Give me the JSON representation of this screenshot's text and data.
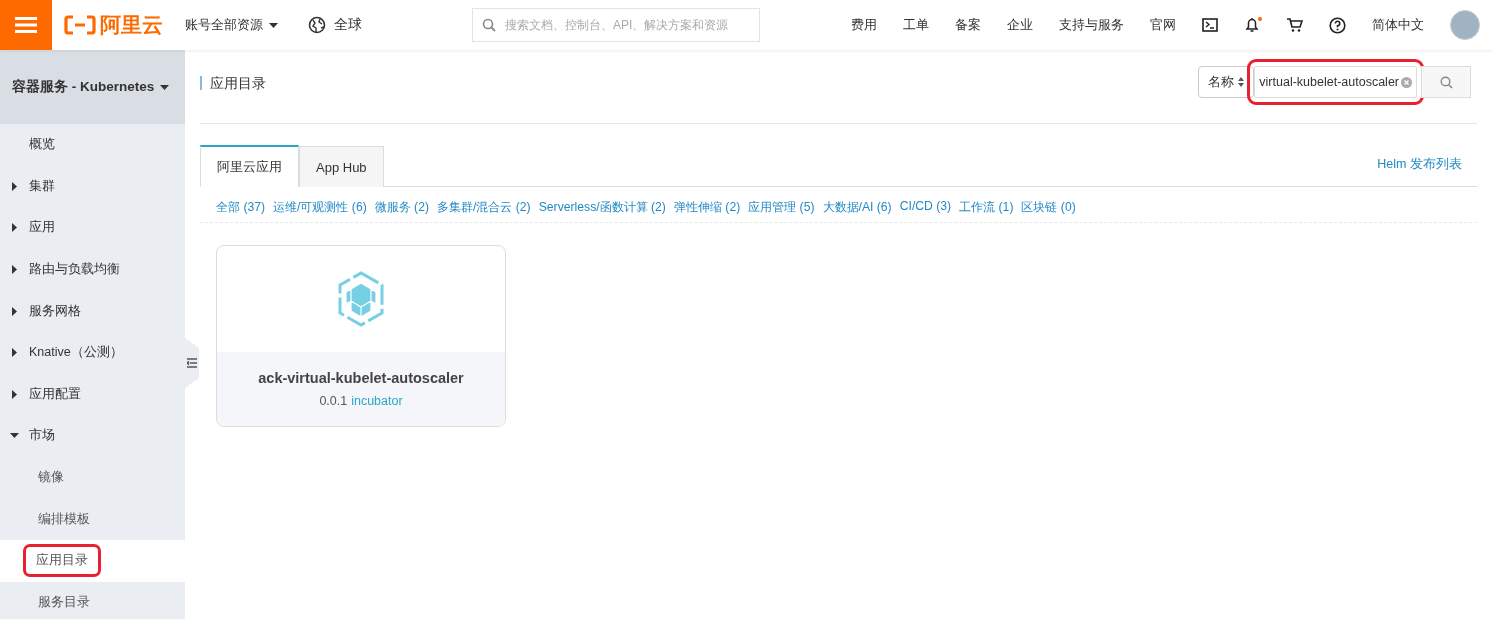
{
  "topbar": {
    "brand": "阿里云",
    "account_menu": "账号全部资源",
    "region": "全球",
    "search": {
      "placeholder": "搜索文档、控制台、API、解决方案和资源"
    },
    "links": [
      "费用",
      "工单",
      "备案",
      "企业",
      "支持与服务",
      "官网"
    ],
    "notification_unread": true,
    "language": "简体中文"
  },
  "sidebar": {
    "title": "容器服务 - Kubernetes",
    "items": [
      {
        "label": "概览",
        "kind": "leaf",
        "selected": false,
        "highlighted": false
      },
      {
        "label": "集群",
        "kind": "group",
        "expanded": false
      },
      {
        "label": "应用",
        "kind": "group",
        "expanded": false
      },
      {
        "label": "路由与负载均衡",
        "kind": "group",
        "expanded": false
      },
      {
        "label": "服务网格",
        "kind": "group",
        "expanded": false
      },
      {
        "label": "Knative（公测）",
        "kind": "group",
        "expanded": false
      },
      {
        "label": "应用配置",
        "kind": "group",
        "expanded": false
      },
      {
        "label": "市场",
        "kind": "group",
        "expanded": true,
        "children": [
          {
            "label": "镜像",
            "kind": "leaf",
            "selected": false,
            "highlighted": false
          },
          {
            "label": "编排模板",
            "kind": "leaf",
            "selected": false,
            "highlighted": false
          },
          {
            "label": "应用目录",
            "kind": "leaf",
            "selected": true,
            "highlighted": true
          },
          {
            "label": "服务目录",
            "kind": "leaf",
            "selected": false,
            "highlighted": false
          }
        ]
      }
    ]
  },
  "page": {
    "title": "应用目录",
    "filter": {
      "field": "名称",
      "value": "virtual-kubelet-autoscaler",
      "highlighted": true
    },
    "tabs": [
      {
        "label": "阿里云应用",
        "selected": true
      },
      {
        "label": "App Hub",
        "selected": false
      }
    ],
    "helm_link": "Helm 发布列表",
    "categories": [
      "全部 (37)",
      "运维/可观测性 (6)",
      "微服务 (2)",
      "多集群/混合云 (2)",
      "Serverless/函数计算 (2)",
      "弹性伸缩 (2)",
      "应用管理 (5)",
      "大数据/AI (6)",
      "CI/CD (3)",
      "工作流 (1)",
      "区块链 (0)"
    ],
    "apps": [
      {
        "name": "ack-virtual-kubelet-autoscaler",
        "version": "0.0.1",
        "repo": "incubator"
      }
    ]
  }
}
